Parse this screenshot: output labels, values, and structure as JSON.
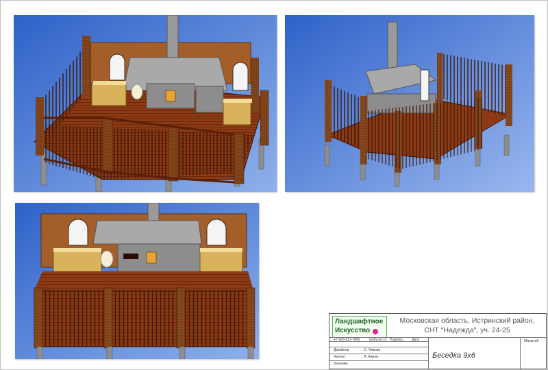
{
  "views": [
    {
      "name": "view-front-isometric"
    },
    {
      "name": "view-rear-isometric"
    },
    {
      "name": "view-front"
    }
  ],
  "title_block": {
    "company_line1": "Ландшафтное",
    "company_line2": "Искусство",
    "address_line1": "Московская область, Истринский район,",
    "address_line2": "СНТ \"Надежда\", уч. 24-25",
    "phone": "+7-925-517-7860",
    "website": "landy-art.ru",
    "col_signature": "Подпись",
    "col_date": "Дата",
    "row1_label": "Дизайнер",
    "row1_name": "С. Чижова",
    "row2_label": "Чертил",
    "row2_name": "Л. Чижов",
    "row3_label": "Заказчик",
    "drawing_title": "Беседка 9х6",
    "scale_label": "Масштаб"
  }
}
